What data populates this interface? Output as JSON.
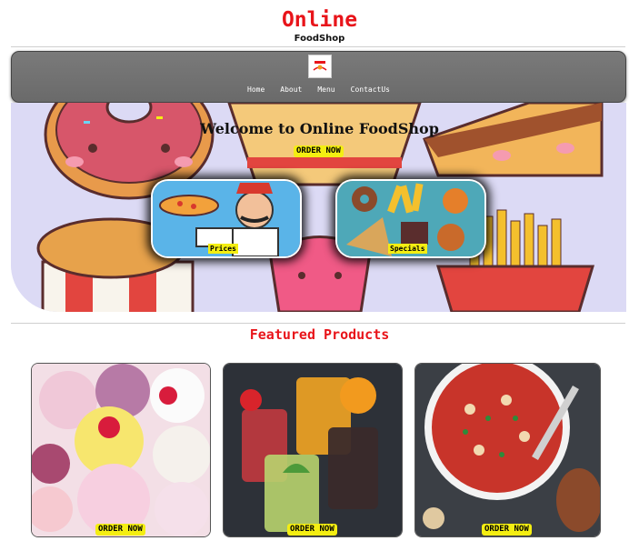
{
  "header": {
    "title": "Online",
    "subtitle": "FoodShop"
  },
  "nav": {
    "logo_text": "Food",
    "links": [
      "Home",
      "About",
      "Menu",
      "ContactUs"
    ]
  },
  "hero": {
    "title": "Welcome to Online FoodShop",
    "order_label": "ORDER NOW",
    "cards": [
      {
        "label": "Prices"
      },
      {
        "label": "Specials"
      }
    ]
  },
  "featured": {
    "title": "Featured Products",
    "products": [
      {
        "order_label": "ORDER NOW"
      },
      {
        "order_label": "ORDER NOW"
      },
      {
        "order_label": "ORDER NOW"
      }
    ]
  },
  "colors": {
    "accent": "#e8141a",
    "button": "#f4ee12",
    "nav": "#707070"
  }
}
